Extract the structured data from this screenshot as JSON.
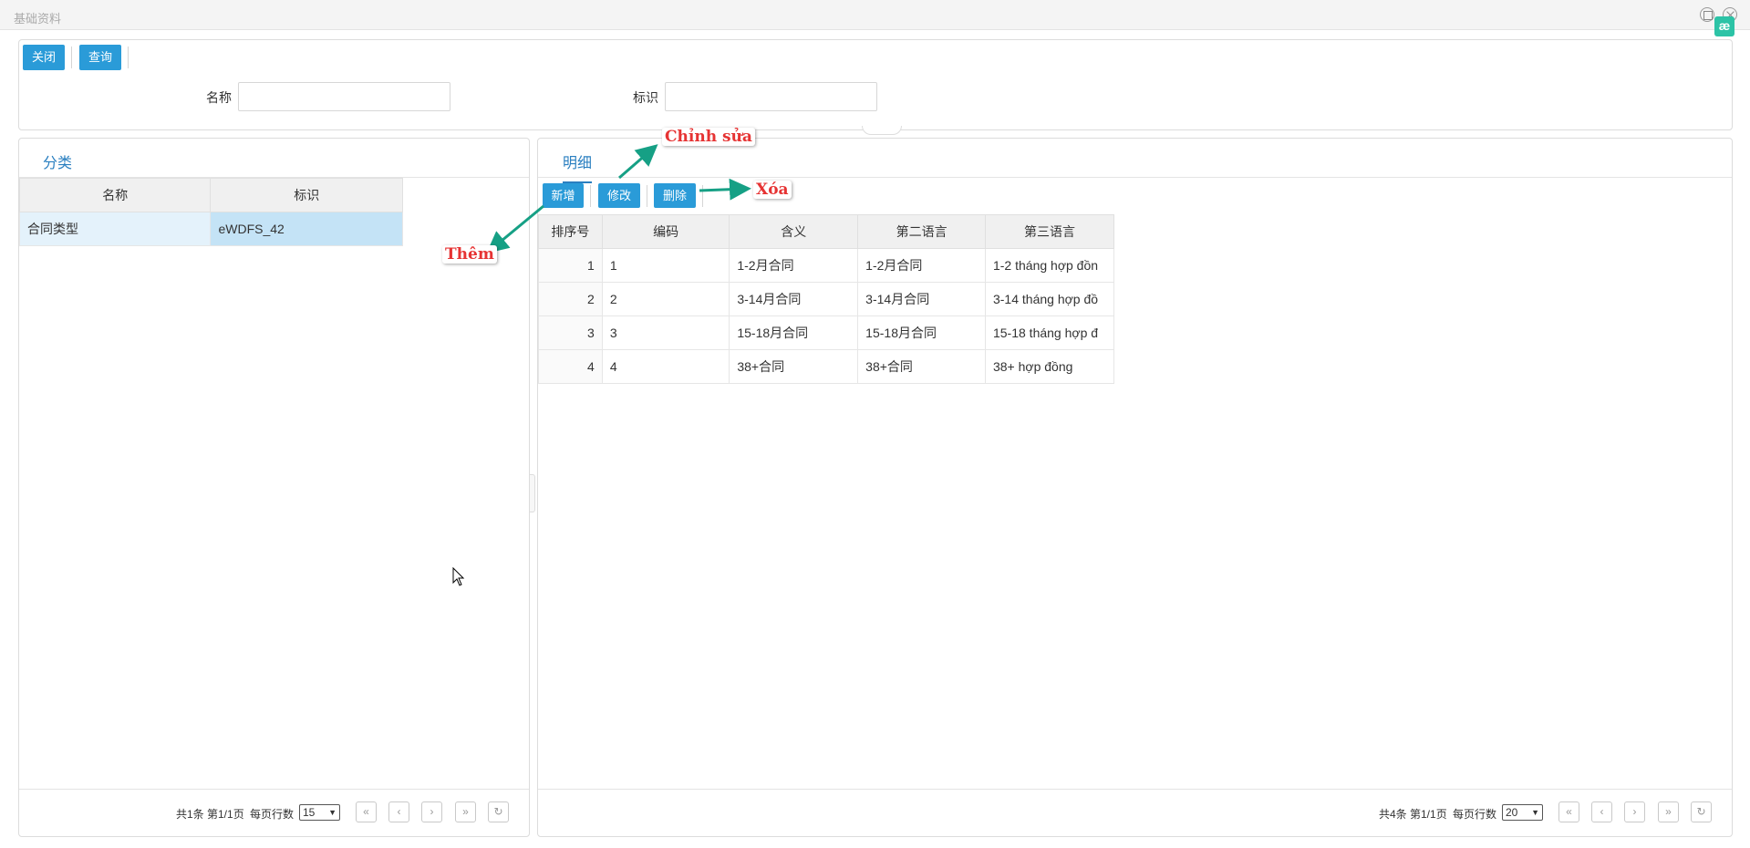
{
  "window": {
    "title": "基础资料",
    "extension_badge": "æ"
  },
  "toolbar": {
    "close_label": "关闭",
    "query_label": "查询"
  },
  "filters": {
    "name_label": "名称",
    "name_value": "",
    "code_label": "标识",
    "code_value": ""
  },
  "left_panel": {
    "tab": "分类",
    "columns": [
      "名称",
      "标识"
    ],
    "rows": [
      {
        "name": "合同类型",
        "code": "eWDFS_42"
      }
    ],
    "pager": {
      "summary": "共1条 第1/1页",
      "per_page_label": "每页行数",
      "per_page": "15"
    }
  },
  "right_panel": {
    "tab": "明细",
    "buttons": {
      "add": "新增",
      "edit": "修改",
      "delete": "删除"
    },
    "columns": [
      "排序号",
      "编码",
      "含义",
      "第二语言",
      "第三语言"
    ],
    "rows": [
      {
        "seq": "1",
        "code": "1",
        "meaning": "1-2月合同",
        "lang2": "1-2月合同",
        "lang3": "1-2 tháng hợp đồn"
      },
      {
        "seq": "2",
        "code": "2",
        "meaning": "3-14月合同",
        "lang2": "3-14月合同",
        "lang3": "3-14 tháng hợp đồ"
      },
      {
        "seq": "3",
        "code": "3",
        "meaning": "15-18月合同",
        "lang2": "15-18月合同",
        "lang3": "15-18 tháng hợp đ"
      },
      {
        "seq": "4",
        "code": "4",
        "meaning": "38+合同",
        "lang2": "38+合同",
        "lang3": "38+ hợp đồng"
      }
    ],
    "pager": {
      "summary": "共4条 第1/1页",
      "per_page_label": "每页行数",
      "per_page": "20"
    }
  },
  "pager_icons": [
    "first-page-icon",
    "prev-page-icon",
    "next-page-icon",
    "last-page-icon",
    "refresh-icon"
  ],
  "annotations": {
    "edit": "Chỉnh sửa",
    "delete": "Xóa",
    "add": "Thêm"
  },
  "colors": {
    "primary_button": "#2a9bd8",
    "tab_accent": "#2a7fc0",
    "annotation_text": "#e63333",
    "annotation_arrow": "#16a085"
  }
}
